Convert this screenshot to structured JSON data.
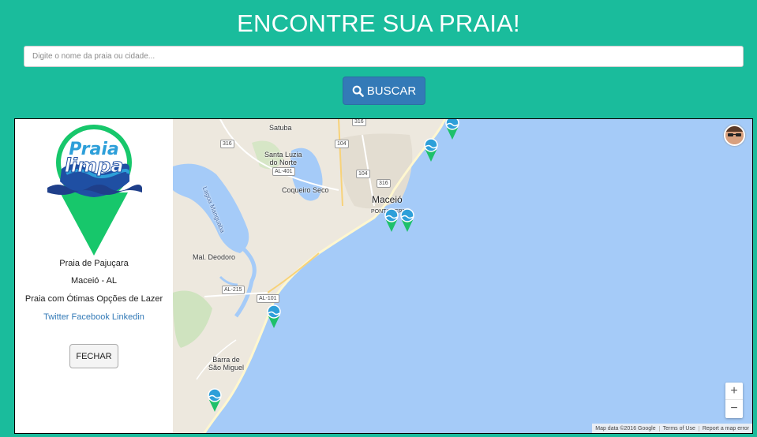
{
  "header": {
    "title": "ENCONTRE SUA PRAIA!"
  },
  "search": {
    "placeholder": "Digite o nome da praia ou cidade...",
    "button_label": "BUSCAR"
  },
  "info": {
    "logo_text": "Praia limpa",
    "beach_name": "Praia de Pajuçara",
    "location": "Maceió - AL",
    "description": "Praia com Ótimas Opções de Lazer",
    "links": [
      "Twitter",
      "Facebook",
      "Linkedin"
    ],
    "close_label": "FECHAR"
  },
  "map": {
    "labels": {
      "satuba": "Satuba",
      "santa_luzia": "Santa Luzia\ndo Norte",
      "coqueiro_seco": "Coqueiro Seco",
      "maceio": "Maceió",
      "ponta_verde": "PONTA VERDE",
      "lagoa": "Lagoa Manguaba",
      "mal_deodoro": "Mal. Deodoro",
      "barra": "Barra de\nSão Miguel"
    },
    "roads": [
      "316",
      "316",
      "104",
      "104",
      "316",
      "AL-401",
      "AL-215",
      "AL-101"
    ],
    "attribution": [
      "Map data ©2016 Google",
      "Terms of Use",
      "Report a map error"
    ],
    "zoom_in": "+",
    "zoom_out": "−",
    "colors": {
      "water": "#a5cbf8",
      "land": "#ede8de",
      "marker": "#1ec06a",
      "marker_badge": "#2d9fd9"
    }
  }
}
